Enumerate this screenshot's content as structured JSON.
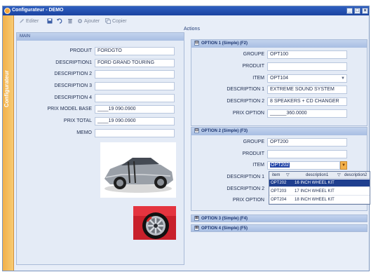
{
  "window": {
    "title": "Configurateur - DEMO",
    "controls": [
      "_",
      "□",
      "×"
    ]
  },
  "rail": {
    "label": "Configurateur"
  },
  "toolbar": {
    "edit_label": "Editer",
    "add_label": "Ajouter",
    "copy_label": "Copier"
  },
  "actions_label": "Actions",
  "main": {
    "header": "MAIN",
    "fields": {
      "produit": {
        "label": "PRODUIT",
        "value": "FORDGTO"
      },
      "description1": {
        "label": "DESCRIPTION1",
        "value": "FORD GRAND TOURING"
      },
      "description2": {
        "label": "DESCRIPTION 2",
        "value": ""
      },
      "description3": {
        "label": "DESCRIPTION 3",
        "value": ""
      },
      "description4": {
        "label": "DESCRIPTION 4",
        "value": ""
      },
      "prix_model_base": {
        "label": "PRIX MODEL BASE",
        "prefix": "____",
        "value": "19 090.0900"
      },
      "prix_total": {
        "label": "PRIX TOTAL",
        "prefix": "____",
        "value": "19 090.0900"
      },
      "memo": {
        "label": "MEMO",
        "value": ""
      }
    }
  },
  "option1": {
    "header": "OPTION 1 (Simple) (F2)",
    "toggle": "⊟",
    "groupe": {
      "label": "GROUPE",
      "value": "OPT100"
    },
    "produit": {
      "label": "PRODUIT",
      "value": ""
    },
    "item": {
      "label": "ITEM",
      "value": "OPT104"
    },
    "description1": {
      "label": "DESCRIPTION 1",
      "value": "EXTREME SOUND SYSTEM"
    },
    "description2": {
      "label": "DESCRIPTION 2",
      "value": "8 SPEAKERS + CD CHANGER"
    },
    "prix_option": {
      "label": "PRIX OPTION",
      "prefix": "______",
      "value": "360.0000"
    }
  },
  "option2": {
    "header": "OPTION 2 (Simple) (F3)",
    "toggle": "⊟",
    "groupe": {
      "label": "GROUPE",
      "value": "OPT200"
    },
    "produit": {
      "label": "PRODUIT",
      "value": ""
    },
    "item": {
      "label": "ITEM",
      "value": "OPT202"
    },
    "description1": {
      "label": "DESCRIPTION 1"
    },
    "description2": {
      "label": "DESCRIPTION 2"
    },
    "prix_option": {
      "label": "PRIX OPTION"
    }
  },
  "dropdown": {
    "columns": [
      "item",
      "description1",
      "description2"
    ],
    "rows": [
      {
        "item": "OPT202",
        "description1": "16 INCH WHEEL KIT",
        "selected": true
      },
      {
        "item": "OPT203",
        "description1": "17 INCH WHEEL KIT",
        "selected": false
      },
      {
        "item": "OPT204",
        "description1": "18 INCH WHEEL KIT",
        "selected": false
      }
    ]
  },
  "option3": {
    "header": "OPTION 3 (Simple) (F4)",
    "toggle": "⊞"
  },
  "option4": {
    "header": "OPTION 4 (Simple) (F5)",
    "toggle": "⊞"
  },
  "colors": {
    "title_bar": "#1a43a0",
    "rail": "#f2b049",
    "panel_header": "#a8bee3",
    "selection": "#1f3f8f"
  }
}
